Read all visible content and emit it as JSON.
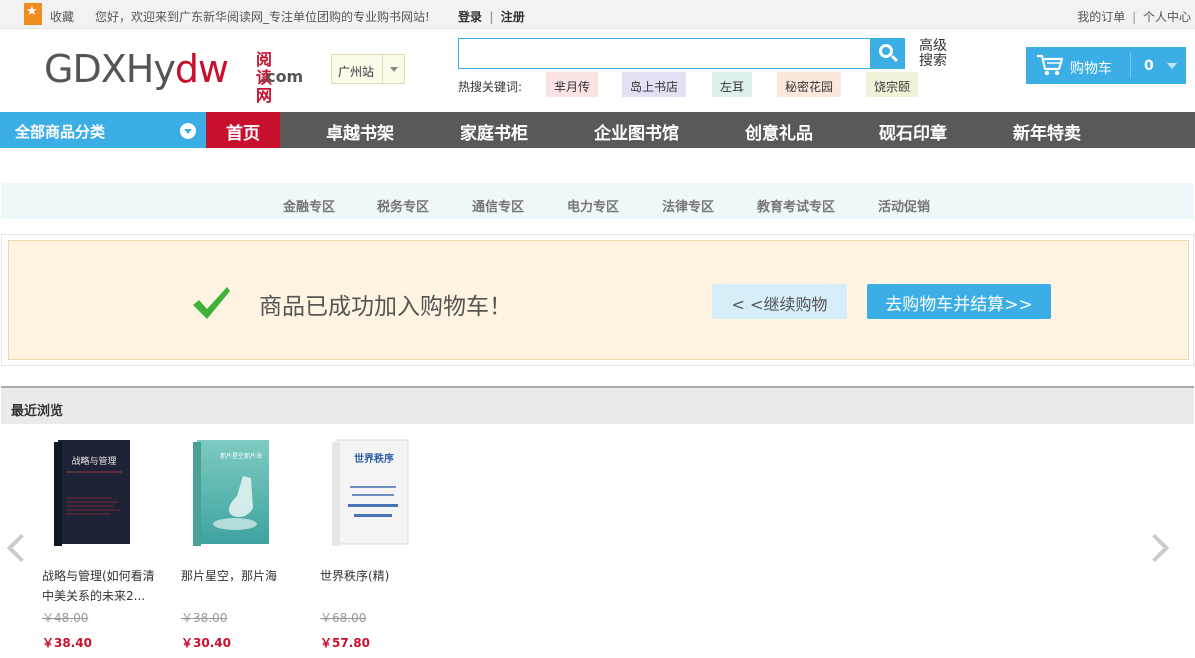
{
  "topbar": {
    "favorite_label": "收藏",
    "welcome": "您好，欢迎来到广东新华阅读网_专注单位团购的专业购书网站!",
    "login": "登录",
    "register": "注册",
    "my_orders": "我的订单",
    "personal_center": "个人中心",
    "separator": "|"
  },
  "logo": {
    "main_gray": "GDXHy",
    "main_red": "dw",
    "side_cn": "阅读网",
    "side_com": ".com"
  },
  "city": {
    "selected": "广州站"
  },
  "search": {
    "placeholder": "",
    "advanced_label": "高级搜索",
    "hot_label": "热搜关键词:",
    "hot_tags": [
      "芈月传",
      "岛上书店",
      "左耳",
      "秘密花园",
      "饶宗颐"
    ],
    "hot_tag_colors": [
      "#fbe3e3",
      "#e4e0f4",
      "#dff1ef",
      "#fbe9de",
      "#f2f1d9"
    ]
  },
  "cart": {
    "label": "购物车",
    "count": "0"
  },
  "nav": {
    "all_categories": "全部商品分类",
    "home": "首页",
    "items": [
      "卓越书架",
      "家庭书柜",
      "企业图书馆",
      "创意礼品",
      "砚石印章",
      "新年特卖"
    ]
  },
  "subnav": [
    "金融专区",
    "税务专区",
    "通信专区",
    "电力专区",
    "法律专区",
    "教育考试专区",
    "活动促销"
  ],
  "success": {
    "message": "商品已成功加入购物车！",
    "continue": "< <继续购物",
    "checkout": "去购物车并结算>>"
  },
  "recent": {
    "title": "最近浏览",
    "products": [
      {
        "title": "战略与管理(如何看清中美关系的未来2...",
        "old_price": "￥48.00",
        "new_price": "￥38.40",
        "cover_title": "战略与管理",
        "cover_color": "#1d2235"
      },
      {
        "title": "那片星空，那片海",
        "old_price": "￥38.00",
        "new_price": "￥30.40",
        "cover_title": "那片星空那片海",
        "cover_color": "#8fd3c8"
      },
      {
        "title": "世界秩序(精)",
        "old_price": "￥68.00",
        "new_price": "￥57.80",
        "cover_title": "世界秩序",
        "cover_color": "#f4f4f4"
      }
    ]
  },
  "colors": {
    "accent": "#3baee6",
    "brand_red": "#c8102e",
    "nav_bg": "#595959"
  }
}
